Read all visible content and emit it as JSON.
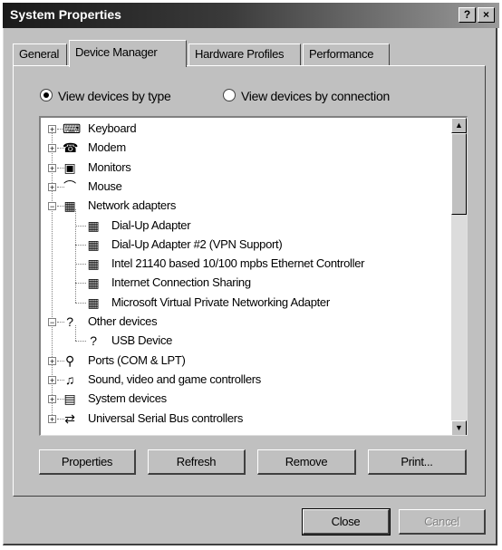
{
  "window": {
    "title": "System Properties",
    "help_label": "?",
    "close_label": "×"
  },
  "tabs": [
    {
      "label": "General"
    },
    {
      "label": "Device Manager"
    },
    {
      "label": "Hardware Profiles"
    },
    {
      "label": "Performance"
    }
  ],
  "active_tab": "Device Manager",
  "view_options": [
    {
      "label": "View devices by type",
      "checked": true
    },
    {
      "label": "View devices by connection",
      "checked": false
    }
  ],
  "device_tree": [
    {
      "label": "Keyboard",
      "icon": "keyboard-icon",
      "level": 0,
      "expander": "+"
    },
    {
      "label": "Modem",
      "icon": "modem-icon",
      "level": 0,
      "expander": "+"
    },
    {
      "label": "Monitors",
      "icon": "monitor-icon",
      "level": 0,
      "expander": "+"
    },
    {
      "label": "Mouse",
      "icon": "mouse-icon",
      "level": 0,
      "expander": "+"
    },
    {
      "label": "Network adapters",
      "icon": "network-card-icon",
      "level": 0,
      "expander": "−"
    },
    {
      "label": "Dial-Up Adapter",
      "icon": "network-card-icon",
      "level": 1
    },
    {
      "label": "Dial-Up Adapter #2 (VPN Support)",
      "icon": "network-card-icon",
      "level": 1
    },
    {
      "label": "Intel 21140 based 10/100 mpbs Ethernet Controller",
      "icon": "network-card-icon",
      "level": 1
    },
    {
      "label": "Internet Connection Sharing",
      "icon": "network-card-icon",
      "level": 1
    },
    {
      "label": "Microsoft Virtual Private Networking Adapter",
      "icon": "network-card-icon",
      "level": 1
    },
    {
      "label": "Other devices",
      "icon": "question-device-icon",
      "level": 0,
      "expander": "−"
    },
    {
      "label": "USB Device",
      "icon": "question-device-icon",
      "level": 1
    },
    {
      "label": "Ports (COM & LPT)",
      "icon": "port-icon",
      "level": 0,
      "expander": "+"
    },
    {
      "label": "Sound, video and game controllers",
      "icon": "sound-icon",
      "level": 0,
      "expander": "+"
    },
    {
      "label": "System devices",
      "icon": "computer-icon",
      "level": 0,
      "expander": "+"
    },
    {
      "label": "Universal Serial Bus controllers",
      "icon": "usb-icon",
      "level": 0,
      "expander": "+"
    }
  ],
  "scroll": {
    "up_label": "▲",
    "down_label": "▼"
  },
  "actions": {
    "properties_label": "Properties",
    "refresh_label": "Refresh",
    "remove_label": "Remove",
    "print_label": "Print..."
  },
  "dialog": {
    "close_label": "Close",
    "cancel_label": "Cancel"
  }
}
